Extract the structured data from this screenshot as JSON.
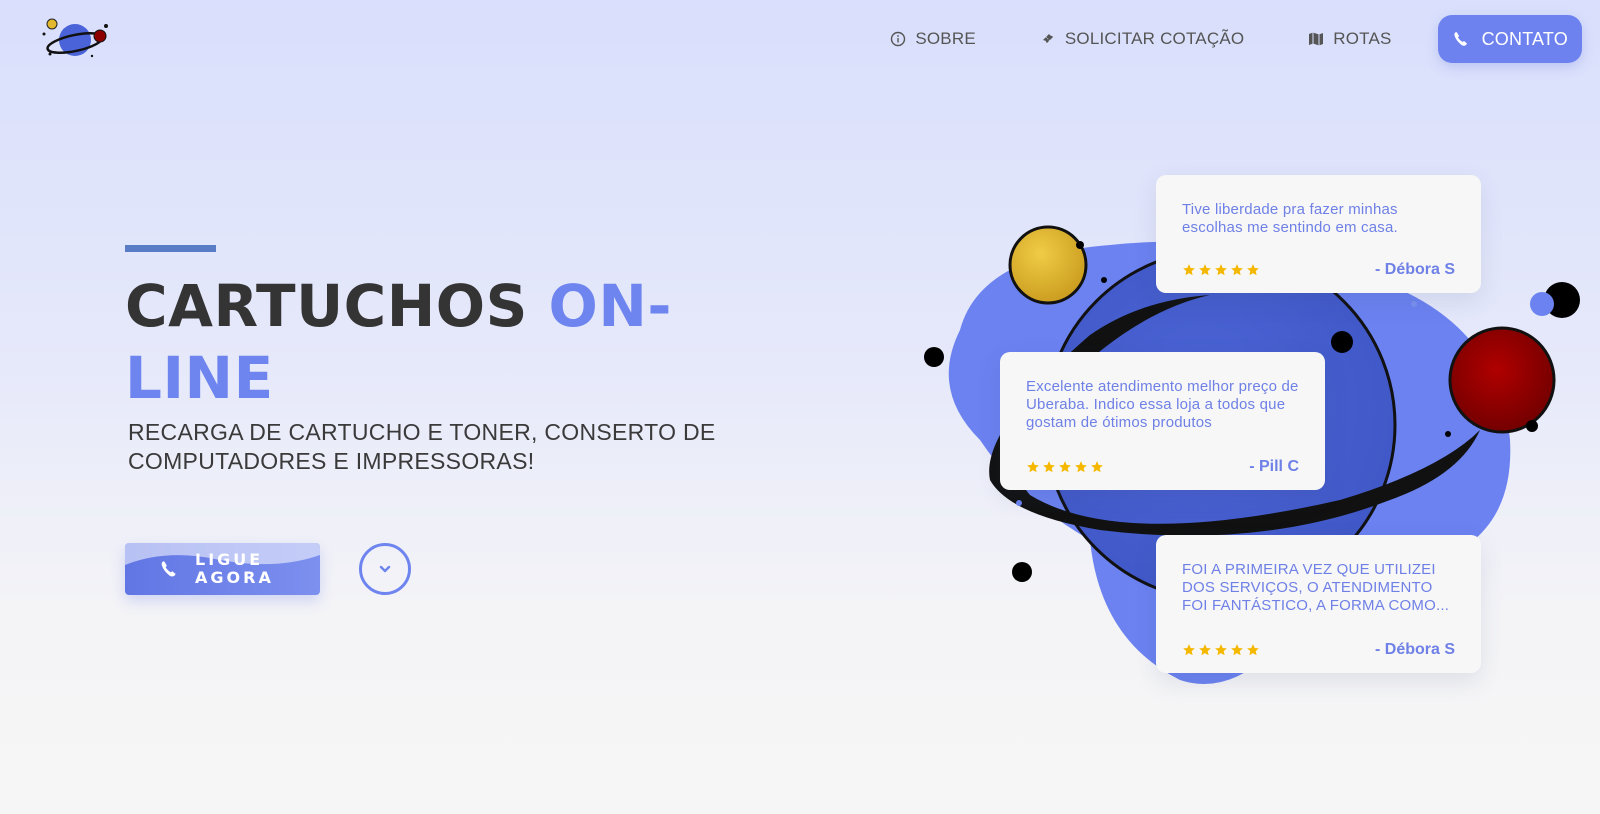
{
  "nav": {
    "items": [
      {
        "label": "SOBRE",
        "icon": "info-circle-icon"
      },
      {
        "label": "SOLICITAR COTAÇÃO",
        "icon": "ticket-icon"
      },
      {
        "label": "ROTAS",
        "icon": "map-icon"
      }
    ],
    "cta": {
      "label": "CONTATO",
      "icon": "phone-icon"
    }
  },
  "hero": {
    "title_part1": "CARTUCHOS ",
    "title_part2": "ON-LINE",
    "subtitle": "RECARGA DE CARTUCHO E TONER, CONSERTO DE COMPUTADORES E IMPRESSORAS!",
    "call_button": "LIGUE AGORA",
    "scroll_icon": "chevron-down-icon"
  },
  "reviews": [
    {
      "text": "Tive liberdade pra fazer minhas escolhas me sentindo em casa.",
      "author": "- Débora S",
      "stars": 5
    },
    {
      "text": "Excelente atendimento melhor preço de Uberaba. Indico essa loja a todos que gostam de ótimos produtos",
      "author": "- Pill C",
      "stars": 5
    },
    {
      "text": "FOI A PRIMEIRA VEZ QUE UTILIZEI DOS SERVIÇOS, O ATENDIMENTO FOI FANTÁSTICO, A FORMA COMO...",
      "author": "- Débora S",
      "stars": 5
    }
  ],
  "colors": {
    "accent": "#6e84ee",
    "star": "#f5b800",
    "planet": "#4a63d8",
    "blob": "#6b82f0",
    "red_planet": "#8c0000",
    "gold_planet": "#e2b82f"
  }
}
